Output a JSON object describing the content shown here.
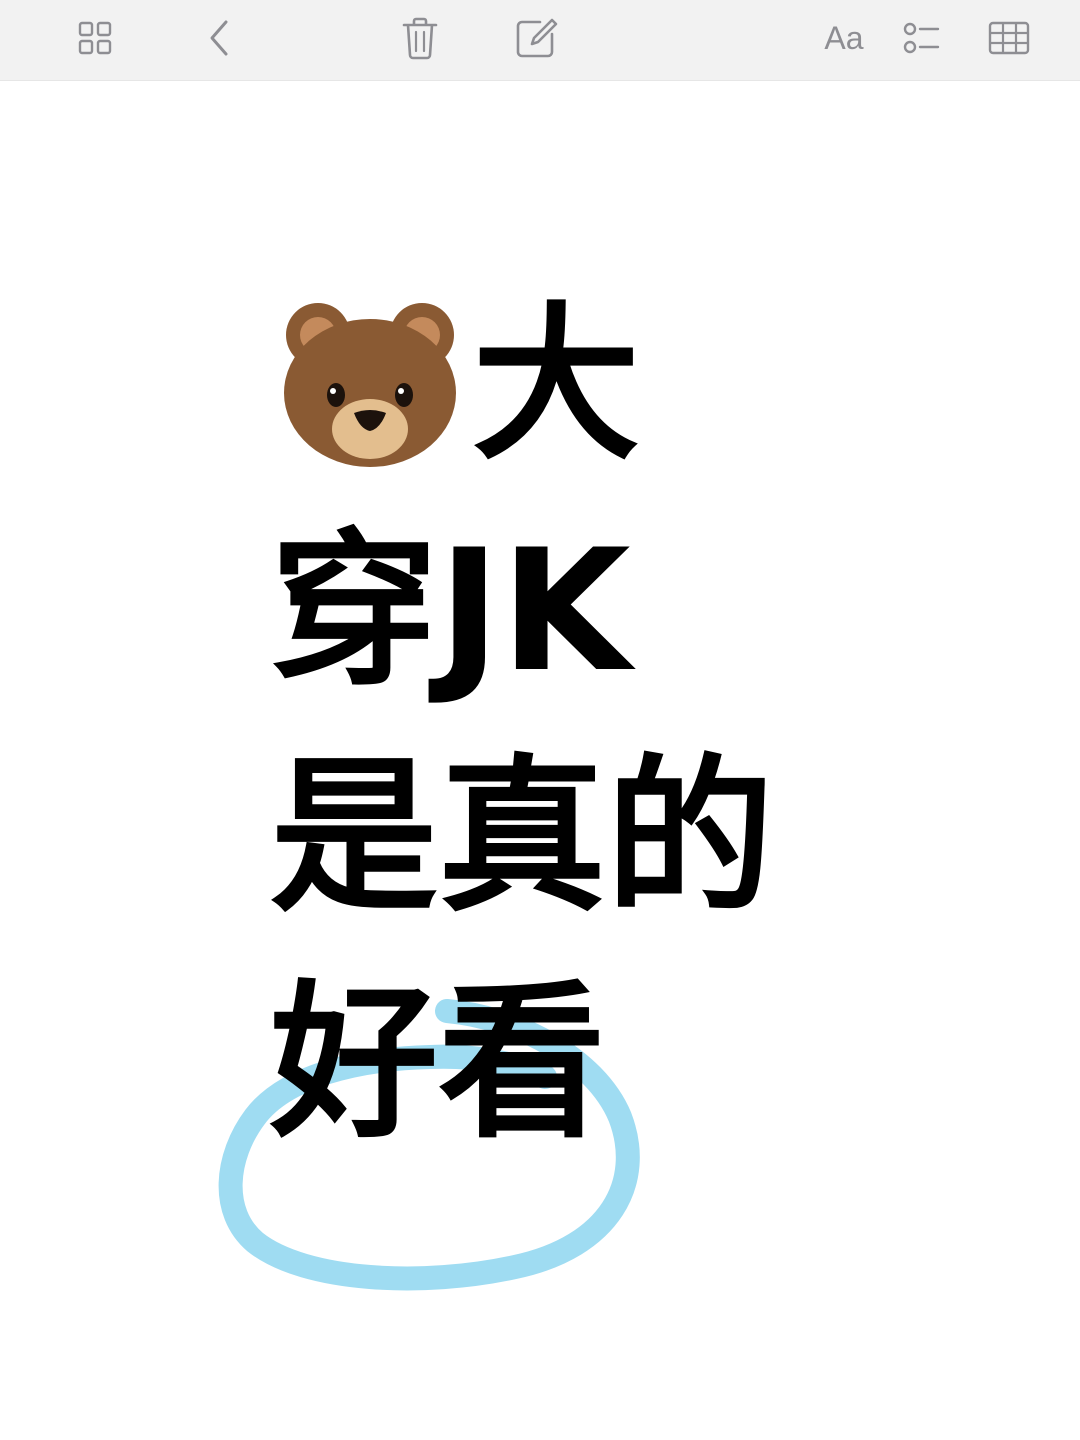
{
  "toolbar": {
    "icon_color": "#8e8e93",
    "font_button_label": "Aa",
    "icons": [
      "grid-view-icon",
      "chevron-left-icon",
      "trash-icon",
      "compose-icon",
      "font-format-icon",
      "checklist-icon",
      "table-icon"
    ]
  },
  "note": {
    "line1": "大",
    "line2": "穿JK",
    "line3": "是真的",
    "line4": "好看",
    "emoji": "bear-face-icon",
    "highlight_color": "#9fdcf2"
  }
}
